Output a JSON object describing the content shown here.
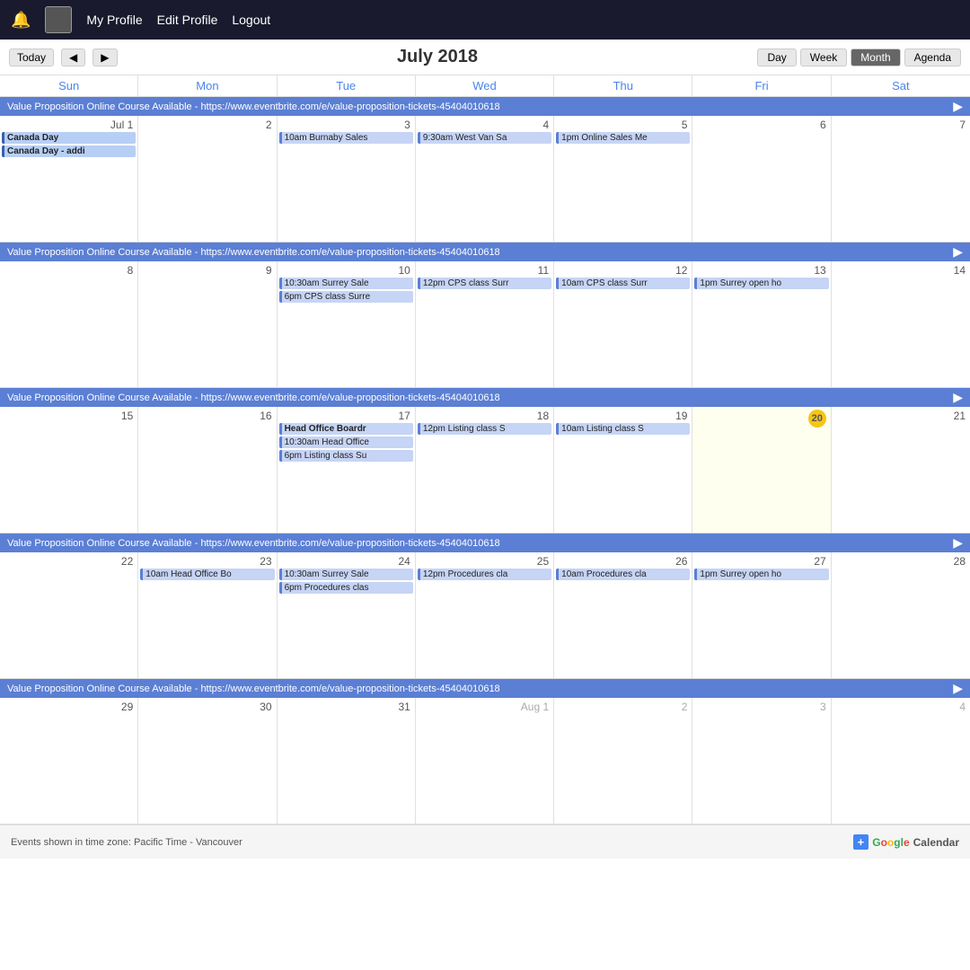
{
  "nav": {
    "my_profile": "My Profile",
    "edit_profile": "Edit Profile",
    "logout": "Logout"
  },
  "calendar": {
    "month_title": "July 2018",
    "views": [
      "Day",
      "Week",
      "Month",
      "Agenda"
    ],
    "active_view": "Month",
    "day_headers": [
      "Sun",
      "Mon",
      "Tue",
      "Wed",
      "Thu",
      "Fri",
      "Sat"
    ],
    "banner_text": "Value Proposition Online Course Available - https://www.eventbrite.com/e/value-proposition-tickets-45404010618",
    "weeks": [
      {
        "days": [
          {
            "num": "Jul 1",
            "other": false,
            "today": false,
            "events": [
              {
                "label": "Canada Day",
                "allday": true
              },
              {
                "label": "Canada Day - addl",
                "allday": true
              }
            ]
          },
          {
            "num": "2",
            "other": false,
            "today": false,
            "events": []
          },
          {
            "num": "3",
            "other": false,
            "today": false,
            "events": [
              {
                "label": "10am Burnaby Sales",
                "allday": false
              }
            ]
          },
          {
            "num": "4",
            "other": false,
            "today": false,
            "events": [
              {
                "label": "9:30am West Van Sa",
                "allday": false
              }
            ]
          },
          {
            "num": "5",
            "other": false,
            "today": false,
            "events": [
              {
                "label": "1pm Online Sales Me",
                "allday": false
              }
            ]
          },
          {
            "num": "6",
            "other": false,
            "today": false,
            "events": []
          },
          {
            "num": "7",
            "other": false,
            "today": false,
            "events": []
          }
        ]
      },
      {
        "days": [
          {
            "num": "8",
            "other": false,
            "today": false,
            "events": []
          },
          {
            "num": "9",
            "other": false,
            "today": false,
            "events": []
          },
          {
            "num": "10",
            "other": false,
            "today": false,
            "events": [
              {
                "label": "10:30am Surrey Sale",
                "allday": false
              },
              {
                "label": "6pm CPS class Surre",
                "allday": false
              }
            ]
          },
          {
            "num": "11",
            "other": false,
            "today": false,
            "events": [
              {
                "label": "12pm CPS class Surr",
                "allday": false
              }
            ]
          },
          {
            "num": "12",
            "other": false,
            "today": false,
            "events": [
              {
                "label": "10am CPS class Surr",
                "allday": false
              }
            ]
          },
          {
            "num": "13",
            "other": false,
            "today": false,
            "events": [
              {
                "label": "1pm Surrey open ho",
                "allday": false
              }
            ]
          },
          {
            "num": "14",
            "other": false,
            "today": false,
            "events": []
          }
        ]
      },
      {
        "days": [
          {
            "num": "15",
            "other": false,
            "today": false,
            "events": []
          },
          {
            "num": "16",
            "other": false,
            "today": false,
            "events": []
          },
          {
            "num": "17",
            "other": false,
            "today": false,
            "events": [
              {
                "label": "Head Office Boardr",
                "allday": false,
                "board": true
              },
              {
                "label": "10:30am Head Office",
                "allday": false
              },
              {
                "label": "6pm Listing class Su",
                "allday": false
              }
            ]
          },
          {
            "num": "18",
            "other": false,
            "today": false,
            "events": [
              {
                "label": "12pm Listing class S",
                "allday": false
              }
            ]
          },
          {
            "num": "19",
            "other": false,
            "today": false,
            "events": [
              {
                "label": "10am Listing class S",
                "allday": false
              }
            ]
          },
          {
            "num": "20",
            "other": false,
            "today": true,
            "events": []
          },
          {
            "num": "21",
            "other": false,
            "today": false,
            "events": []
          }
        ]
      },
      {
        "days": [
          {
            "num": "22",
            "other": false,
            "today": false,
            "events": []
          },
          {
            "num": "23",
            "other": false,
            "today": false,
            "events": [
              {
                "label": "10am Head Office Bo",
                "allday": false
              }
            ]
          },
          {
            "num": "24",
            "other": false,
            "today": false,
            "events": [
              {
                "label": "10:30am Surrey Sale",
                "allday": false
              },
              {
                "label": "6pm Procedures clas",
                "allday": false
              }
            ]
          },
          {
            "num": "25",
            "other": false,
            "today": false,
            "events": [
              {
                "label": "12pm Procedures cla",
                "allday": false
              }
            ]
          },
          {
            "num": "26",
            "other": false,
            "today": false,
            "events": [
              {
                "label": "10am Procedures cla",
                "allday": false
              }
            ]
          },
          {
            "num": "27",
            "other": false,
            "today": false,
            "events": [
              {
                "label": "1pm Surrey open ho",
                "allday": false
              }
            ]
          },
          {
            "num": "28",
            "other": false,
            "today": false,
            "events": []
          }
        ]
      },
      {
        "days": [
          {
            "num": "29",
            "other": false,
            "today": false,
            "events": []
          },
          {
            "num": "30",
            "other": false,
            "today": false,
            "events": []
          },
          {
            "num": "31",
            "other": false,
            "today": false,
            "events": []
          },
          {
            "num": "Aug 1",
            "other": true,
            "today": false,
            "events": []
          },
          {
            "num": "2",
            "other": true,
            "today": false,
            "events": []
          },
          {
            "num": "3",
            "other": true,
            "today": false,
            "events": []
          },
          {
            "num": "4",
            "other": true,
            "today": false,
            "events": []
          }
        ]
      }
    ]
  },
  "footer": {
    "timezone_text": "Events shown in time zone: Pacific Time - Vancouver",
    "google_label": "Google Calendar",
    "google_plus": "+"
  }
}
